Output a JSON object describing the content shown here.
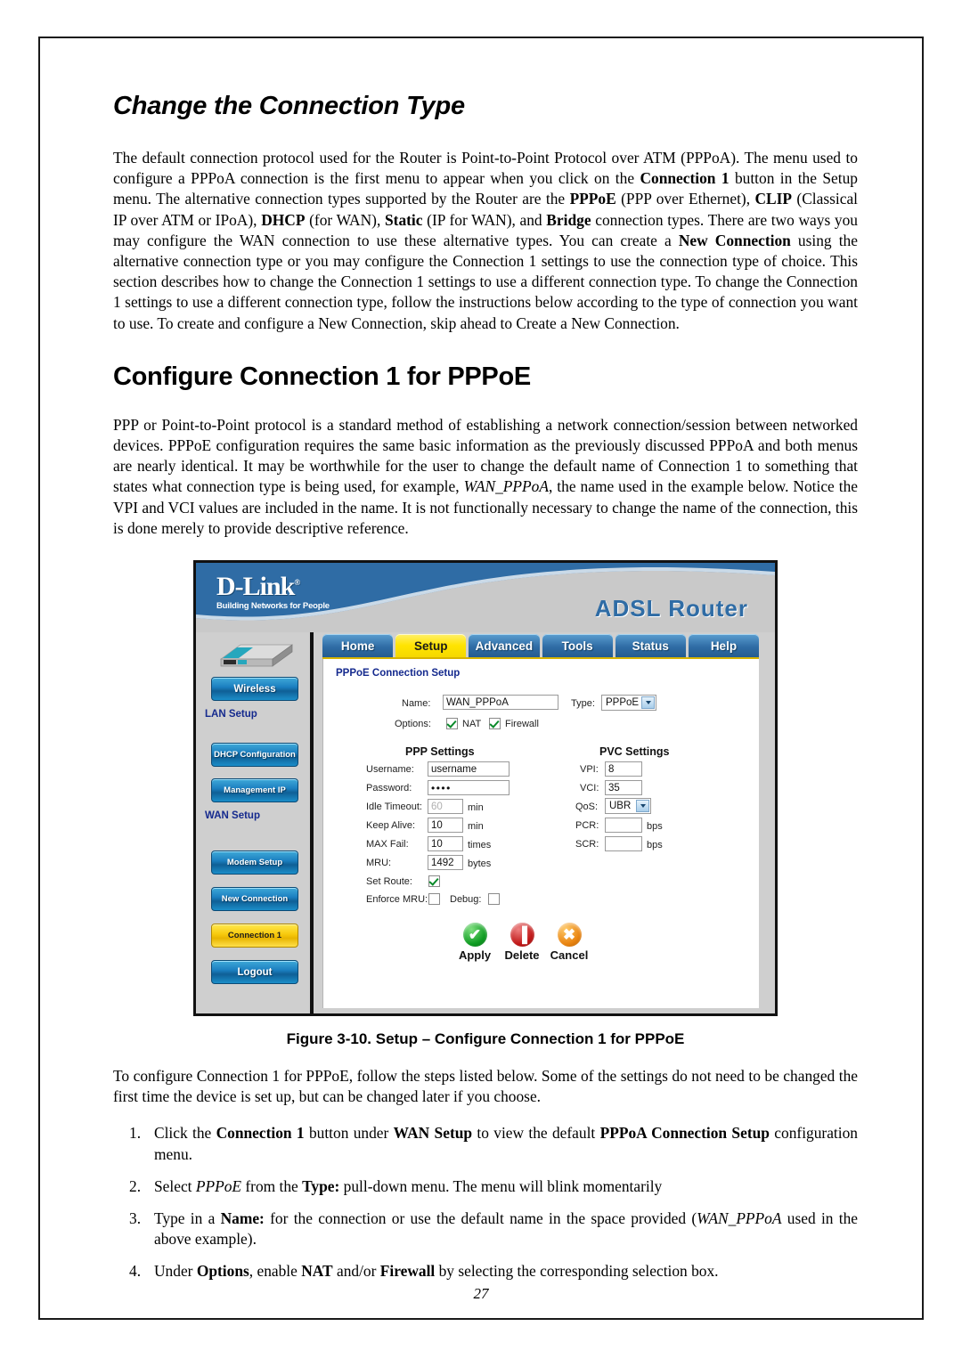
{
  "document": {
    "page_number": "27",
    "heading1": "Change the Connection Type",
    "heading2": "Configure Connection 1 for PPPoE",
    "paragraph1": {
      "p1": "The default connection protocol used for the Router is Point-to-Point Protocol over ATM (PPPoA). The menu used to configure a PPPoA connection is the first menu to appear when you click on the ",
      "b1": "Connection 1",
      "p2": " button in the Setup menu. The alternative connection types supported by the Router are the ",
      "b2": "PPPoE",
      "p3": " (PPP over Ethernet), ",
      "b3": "CLIP",
      "p4": " (Classical IP over ATM or IPoA), ",
      "b4": "DHCP",
      "p5": " (for WAN), ",
      "b5": "Static",
      "p6": " (IP for WAN), and ",
      "b6": "Bridge",
      "p7": " connection types. There are two ways you may configure the WAN connection to use these alternative types. You can create a ",
      "b7": "New Connection",
      "p8": " using the alternative connection type or you may configure the Connection 1 settings to use the connection type of choice. This section describes how to change the Connection 1 settings to use a different connection type. To change the Connection 1 settings to use a different connection type, follow the instructions below according to the type of connection you want to use. To create and configure a New Connection, skip ahead to Create a New Connection."
    },
    "paragraph2": {
      "p1": "PPP or Point-to-Point protocol is a standard method of establishing a network connection/session between networked devices. PPPoE configuration requires the same basic information as the previously discussed PPPoA and both menus are nearly identical. It may be worthwhile for the user to change the default name of Connection 1 to something that states what connection type is being used, for example, ",
      "i1": "WAN_PPPoA",
      "p2": ", the name used in the example below. Notice the VPI and VCI values are included in the name. It is not functionally necessary to change the name of the connection, this is done merely to provide descriptive reference."
    },
    "figure_caption": "Figure 3-10. Setup – Configure Connection 1 for PPPoE",
    "paragraph3": "To configure Connection 1 for PPPoE, follow the steps listed below. Some of the settings do not need to be changed the first time the device is set up, but can be changed later if you choose.",
    "steps": [
      {
        "p1": "Click the ",
        "b1": "Connection 1",
        "p2": " button under ",
        "b2": "WAN Setup",
        "p3": " to view the default ",
        "b3": "PPPoA Connection Setup",
        "p4": " configuration menu."
      },
      {
        "p1": "Select ",
        "i1": "PPPoE",
        "p2": " from the ",
        "b1": "Type:",
        "p3": " pull-down menu. The menu will blink momentarily"
      },
      {
        "p1": "Type in a ",
        "b1": "Name:",
        "p2": " for the connection or use the default name in the space provided (",
        "i1": "WAN_PPPoA",
        "p3": " used in the above example)."
      },
      {
        "p1": "Under ",
        "b1": "Options",
        "p2": ", enable ",
        "b2": "NAT",
        "p3": " and/or ",
        "b3": "Firewall",
        "p4": " by selecting the corresponding selection box."
      }
    ]
  },
  "router_ui": {
    "brand": {
      "name": "D-Link",
      "registered": "®",
      "tagline": "Building Networks for People",
      "product_title": "ADSL Router"
    },
    "nav_tabs": [
      {
        "label": "Home",
        "active": false
      },
      {
        "label": "Setup",
        "active": true
      },
      {
        "label": "Advanced",
        "active": false
      },
      {
        "label": "Tools",
        "active": false
      },
      {
        "label": "Status",
        "active": false
      },
      {
        "label": "Help",
        "active": false
      }
    ],
    "sidebar": {
      "buttons": [
        {
          "label": "Wireless",
          "active": false
        },
        {
          "label": "DHCP Configuration",
          "active": false
        },
        {
          "label": "Management IP",
          "active": false
        },
        {
          "label": "Modem Setup",
          "active": false
        },
        {
          "label": "New Connection",
          "active": false
        },
        {
          "label": "Connection 1",
          "active": true
        },
        {
          "label": "Logout",
          "active": false
        }
      ],
      "section_lan": "LAN Setup",
      "section_wan": "WAN Setup"
    },
    "panel": {
      "title": "PPPoE Connection Setup",
      "name_label": "Name:",
      "name_value": "WAN_PPPoA",
      "type_label": "Type:",
      "type_value": "PPPoE",
      "options_label": "Options:",
      "nat_label": "NAT",
      "nat_checked": true,
      "firewall_label": "Firewall",
      "firewall_checked": true,
      "ppp_settings_title": "PPP Settings",
      "pvc_settings_title": "PVC Settings",
      "ppp_fields": {
        "username_label": "Username:",
        "username_value": "username",
        "password_label": "Password:",
        "password_value": "••••",
        "idle_timeout_label": "Idle Timeout:",
        "idle_timeout_value": "60",
        "idle_timeout_unit": "min",
        "keep_alive_label": "Keep Alive:",
        "keep_alive_value": "10",
        "keep_alive_unit": "min",
        "max_fail_label": "MAX Fail:",
        "max_fail_value": "10",
        "max_fail_unit": "times",
        "mru_label": "MRU:",
        "mru_value": "1492",
        "mru_unit": "bytes",
        "set_route_label": "Set Route:",
        "set_route_checked": true,
        "enforce_mru_label": "Enforce MRU:",
        "enforce_mru_checked": false,
        "debug_label": "Debug:",
        "debug_checked": false
      },
      "pvc_fields": {
        "vpi_label": "VPI:",
        "vpi_value": "8",
        "vci_label": "VCI:",
        "vci_value": "35",
        "qos_label": "QoS:",
        "qos_value": "UBR",
        "pcr_label": "PCR:",
        "pcr_value": "",
        "pcr_unit": "bps",
        "scr_label": "SCR:",
        "scr_value": "",
        "scr_unit": "bps"
      },
      "actions": [
        {
          "label": "Apply",
          "glyph": "✔",
          "kind": "apply"
        },
        {
          "label": "Delete",
          "glyph": "▐",
          "kind": "delete"
        },
        {
          "label": "Cancel",
          "glyph": "✖",
          "kind": "cancel"
        }
      ]
    },
    "colors": {
      "brand_blue": "#2f6ca5",
      "accent_yellow": "#ffe400",
      "panel_heading": "#152a8e"
    }
  }
}
